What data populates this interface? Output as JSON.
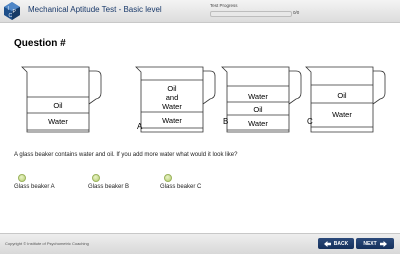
{
  "header": {
    "title": "Mechanical Aptitude Test - Basic level",
    "progress_label": "Test Progress",
    "progress_count": "0/0",
    "progress_value": 0,
    "logo_icon": "ipc-logo-icon"
  },
  "question": {
    "title": "Question #",
    "text": "A glass beaker contains water and oil. If you add more water what would it look like?"
  },
  "figure": {
    "original": {
      "layers": [
        "Oil",
        "Water"
      ]
    },
    "beaker_a": {
      "letter": "A",
      "layers": [
        "Oil",
        "and",
        "Water",
        "Water"
      ]
    },
    "beaker_b": {
      "letter": "B",
      "layers": [
        "Water",
        "Oil",
        "Water"
      ]
    },
    "beaker_c": {
      "letter": "C",
      "layers": [
        "Oil",
        "Water"
      ]
    }
  },
  "options": [
    {
      "label": "Glass beaker A"
    },
    {
      "label": "Glass beaker B"
    },
    {
      "label": "Glass beaker C"
    }
  ],
  "footer": {
    "copyright": "Copyright © Institute of Psychometric Coaching",
    "back_label": "BACK",
    "next_label": "NEXT",
    "back_icon": "arrow-left-icon",
    "next_icon": "arrow-right-icon"
  },
  "colors": {
    "brand": "#1a3a6b",
    "button": "#1f3d6d",
    "radio": "#b7cf74"
  }
}
